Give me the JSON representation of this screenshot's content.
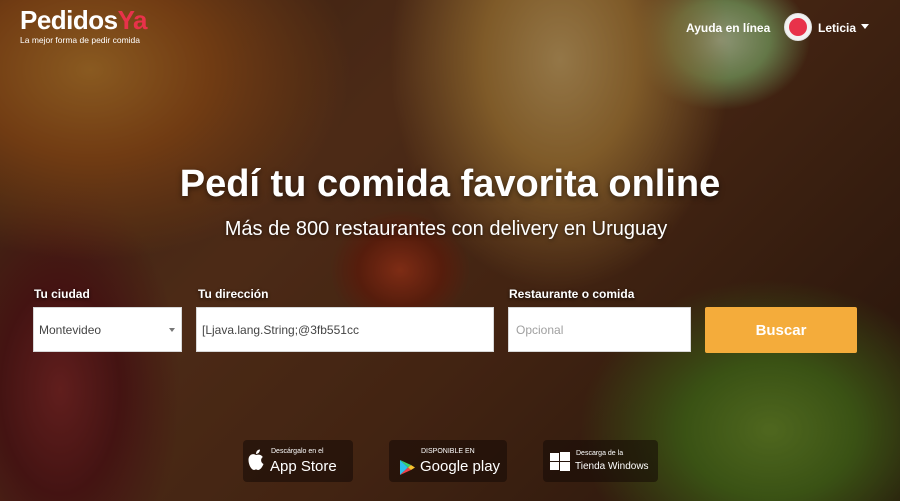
{
  "brand": {
    "name_part1": "Pedidos",
    "name_part2": "Ya",
    "tagline": "La mejor forma de pedir comida",
    "accent_color": "#e8324a"
  },
  "header": {
    "help_link": "Ayuda en línea",
    "user_name": "Leticia",
    "user_avatar_icon": "user-avatar-icon",
    "user_menu_icon": "caret-down-icon"
  },
  "hero": {
    "title": "Pedí tu comida favorita online",
    "subtitle": "Más de 800 restaurantes con delivery en Uruguay"
  },
  "search_form": {
    "city_label": "Tu ciudad",
    "city_value": "Montevideo",
    "address_label": "Tu dirección",
    "address_value": "[Ljava.lang.String;@3fb551cc",
    "food_label": "Restaurante o comida",
    "food_placeholder": "Opcional",
    "search_button": "Buscar",
    "button_color": "#f4ac3b"
  },
  "store_badges": {
    "apple_small": "Descárgalo en el",
    "apple_big": "App Store",
    "apple_icon": "apple-icon",
    "google_small": "DISPONIBLE EN",
    "google_big": "Google play",
    "google_icon": "google-play-icon",
    "windows_small": "Descarga de la",
    "windows_big": "Tienda Windows",
    "windows_icon": "windows-icon"
  }
}
